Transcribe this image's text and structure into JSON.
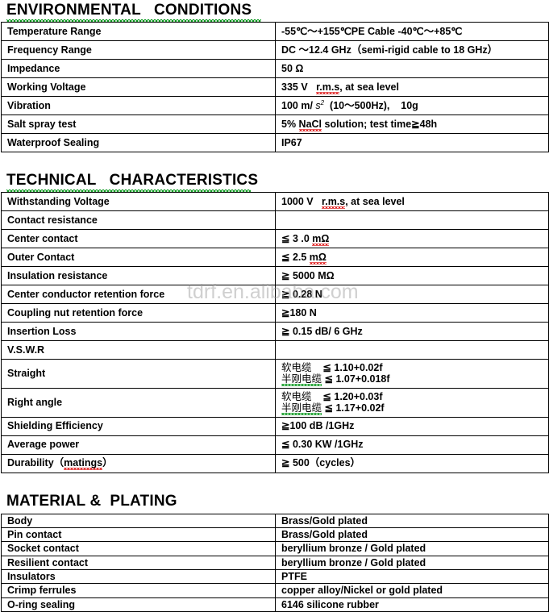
{
  "watermark": "tdrf.en.alibaba.com",
  "sections": [
    {
      "heading": "ENVIRONMENTAL   CONDITIONS",
      "has_green_underline": true,
      "rows": [
        {
          "label": "Temperature Range",
          "value": "-55℃～+155℃PE Cable -40℃～+85℃"
        },
        {
          "label": "Frequency Range",
          "value": "DC ～12.4 GHz（semi-rigid cable to 18 GHz）"
        },
        {
          "label": "Impedance",
          "value": "50 Ω"
        },
        {
          "label": "Working Voltage",
          "value": "335 V",
          "value_suffix": ", at sea level",
          "value_misspelled": "r.m.s"
        },
        {
          "label": "Vibration",
          "value": "100 m/ s²  (10～500Hz),    10g"
        },
        {
          "label": "Salt spray test",
          "value": "5% NaCl solution; test time≧ 48h",
          "value_misspelled": "NaCl"
        },
        {
          "label": "Waterproof Sealing",
          "value": "IP67"
        }
      ]
    },
    {
      "heading": "TECHNICAL   CHARACTERISTICS",
      "has_green_underline": true,
      "rows": [
        {
          "label": "Withstanding Voltage",
          "value": "1000 V",
          "value_suffix": ", at sea level",
          "value_misspelled": "r.m.s"
        },
        {
          "label": "Contact resistance",
          "value": ""
        },
        {
          "label": "Center contact",
          "value": "≦ 3 .0 mΩ",
          "value_misspelled": "mΩ"
        },
        {
          "label": "Outer Contact",
          "value": "≦ 2.5 mΩ",
          "value_misspelled": "mΩ"
        },
        {
          "label": "Insulation resistance",
          "value": "≧ 5000 MΩ"
        },
        {
          "label": "Center conductor retention force",
          "value": "≧ 0.28 N"
        },
        {
          "label": "Coupling nut retention force",
          "value": "≧180 N"
        },
        {
          "label": "Insertion Loss",
          "value": "≧ 0.15 dB/ 6 GHz"
        },
        {
          "label": "V.S.W.R",
          "value": ""
        },
        {
          "label": "Straight",
          "value_lines": [
            {
              "cn": "软电缆",
              "val": "≦ 1.10+0.02f"
            },
            {
              "cn": "半刚电缆",
              "val": "≦ 1.07+0.018f",
              "cn_underlined": true
            }
          ]
        },
        {
          "label": "Right angle",
          "value_lines": [
            {
              "cn": "软电缆",
              "val": "≦ 1.20+0.03f"
            },
            {
              "cn": "半刚电缆",
              "val": "≦ 1.17+0.02f",
              "cn_underlined": true
            }
          ]
        },
        {
          "label": "Shielding Efficiency",
          "value": "≧100 dB /1GHz"
        },
        {
          "label": "Average power",
          "value": "≦ 0.30 KW /1GHz"
        },
        {
          "label": "Durability（matings）",
          "value": "≧ 500（cycles）",
          "label_misspelled": "matings"
        }
      ]
    },
    {
      "heading": "MATERIAL &  PLATING",
      "has_green_underline": false,
      "compact": true,
      "rows": [
        {
          "label": "Body",
          "value": "Brass/Gold plated"
        },
        {
          "label": "Pin contact",
          "value": "Brass/Gold plated"
        },
        {
          "label": "Socket contact",
          "value": "beryllium bronze / Gold plated"
        },
        {
          "label": "Resilient contact",
          "value": "beryllium bronze / Gold plated"
        },
        {
          "label": "Insulators",
          "value": "PTFE"
        },
        {
          "label": "Crimp ferrules",
          "value": "copper alloy/Nickel or gold plated"
        },
        {
          "label": "O-ring sealing",
          "value": "6146 silicone rubber"
        }
      ]
    }
  ]
}
